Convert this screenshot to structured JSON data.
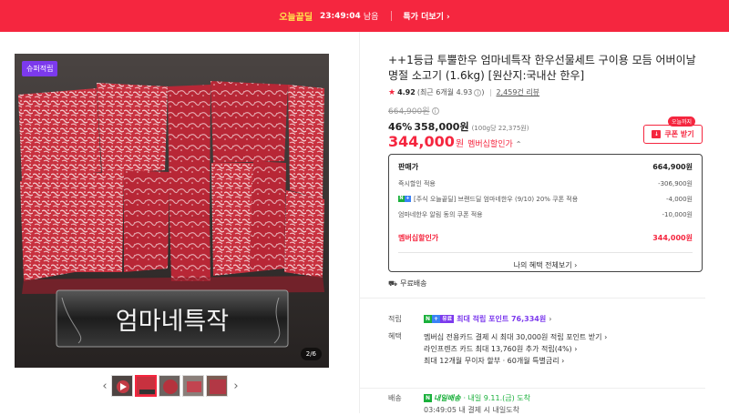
{
  "banner": {
    "brand": "오늘끝딜",
    "timer": "23:49:04",
    "remaining": "남음",
    "more_link": "특가 더보기 ›"
  },
  "gallery": {
    "tag": "슈퍼적립",
    "pager": "2/6",
    "sign_text": "엄마네특작",
    "prev": "‹",
    "next": "›",
    "thumb_count": 5,
    "active_thumb": 1
  },
  "product": {
    "title": "++1등급 투뿔한우 엄마네특작 한우선물세트 구이용 모듬 어버이날 명절 소고기 (1.6kg) [원산지:국내산 한우]",
    "rating": "4.92",
    "rating_recent": "(최근 6개월 4.93",
    "rating_recent_close": ")",
    "reviews": "2,459건 리뷰",
    "original_price": "664,900원",
    "discount_pct": "46%",
    "sale_price": "358,000원",
    "unit_price": "(100g당 22,375원)",
    "member_price": "344,000",
    "member_won": "원",
    "member_label": "멤버십할인가",
    "coupon_badge": "오늘까지",
    "coupon_button": "쿠폰 받기"
  },
  "breakdown": {
    "rows": [
      {
        "label": "판매가",
        "value": "664,900원"
      },
      {
        "label": "즉시할인 적용",
        "value": "-306,900원"
      },
      {
        "label": "[주식 오늘끝딜] 브랜드딜 엄마네한우 (9/10) 20% 쿠폰 적용",
        "value": "-4,000원"
      },
      {
        "label": "엄마네한우 알림 동의 쿠폰 적용",
        "value": "-10,000원"
      }
    ],
    "total_label": "멤버십할인가",
    "total_value": "344,000원",
    "benefit_link": "나의 혜택 전체보기 ›"
  },
  "shipping": {
    "free": "무료배송"
  },
  "points": {
    "label": "적립",
    "badge1": "N",
    "badge2": "+",
    "badge3": "유료",
    "text": "최대 적립 포인트 76,334원",
    "chev": "›"
  },
  "benefits": {
    "label": "혜택",
    "items": [
      "멤버십 전용카드 결제 시 최대 30,000원 적립 포인트 받기 ›",
      "라인프렌즈 카드 최대 13,760원 추가 적립(4%) ›",
      "최대 12개월 무이자 할부 · 60개월 특별금리 ›"
    ]
  },
  "delivery": {
    "label": "배송",
    "badge": "N",
    "type": "내일배송",
    "arrival": "· 내일 9.11.(금) 도착",
    "cutoff": "03:49:05 내 결제 시 내일도착"
  },
  "colors": {
    "accent": "#f5263f",
    "purple": "#7c3aed",
    "green": "#1ab03b"
  }
}
